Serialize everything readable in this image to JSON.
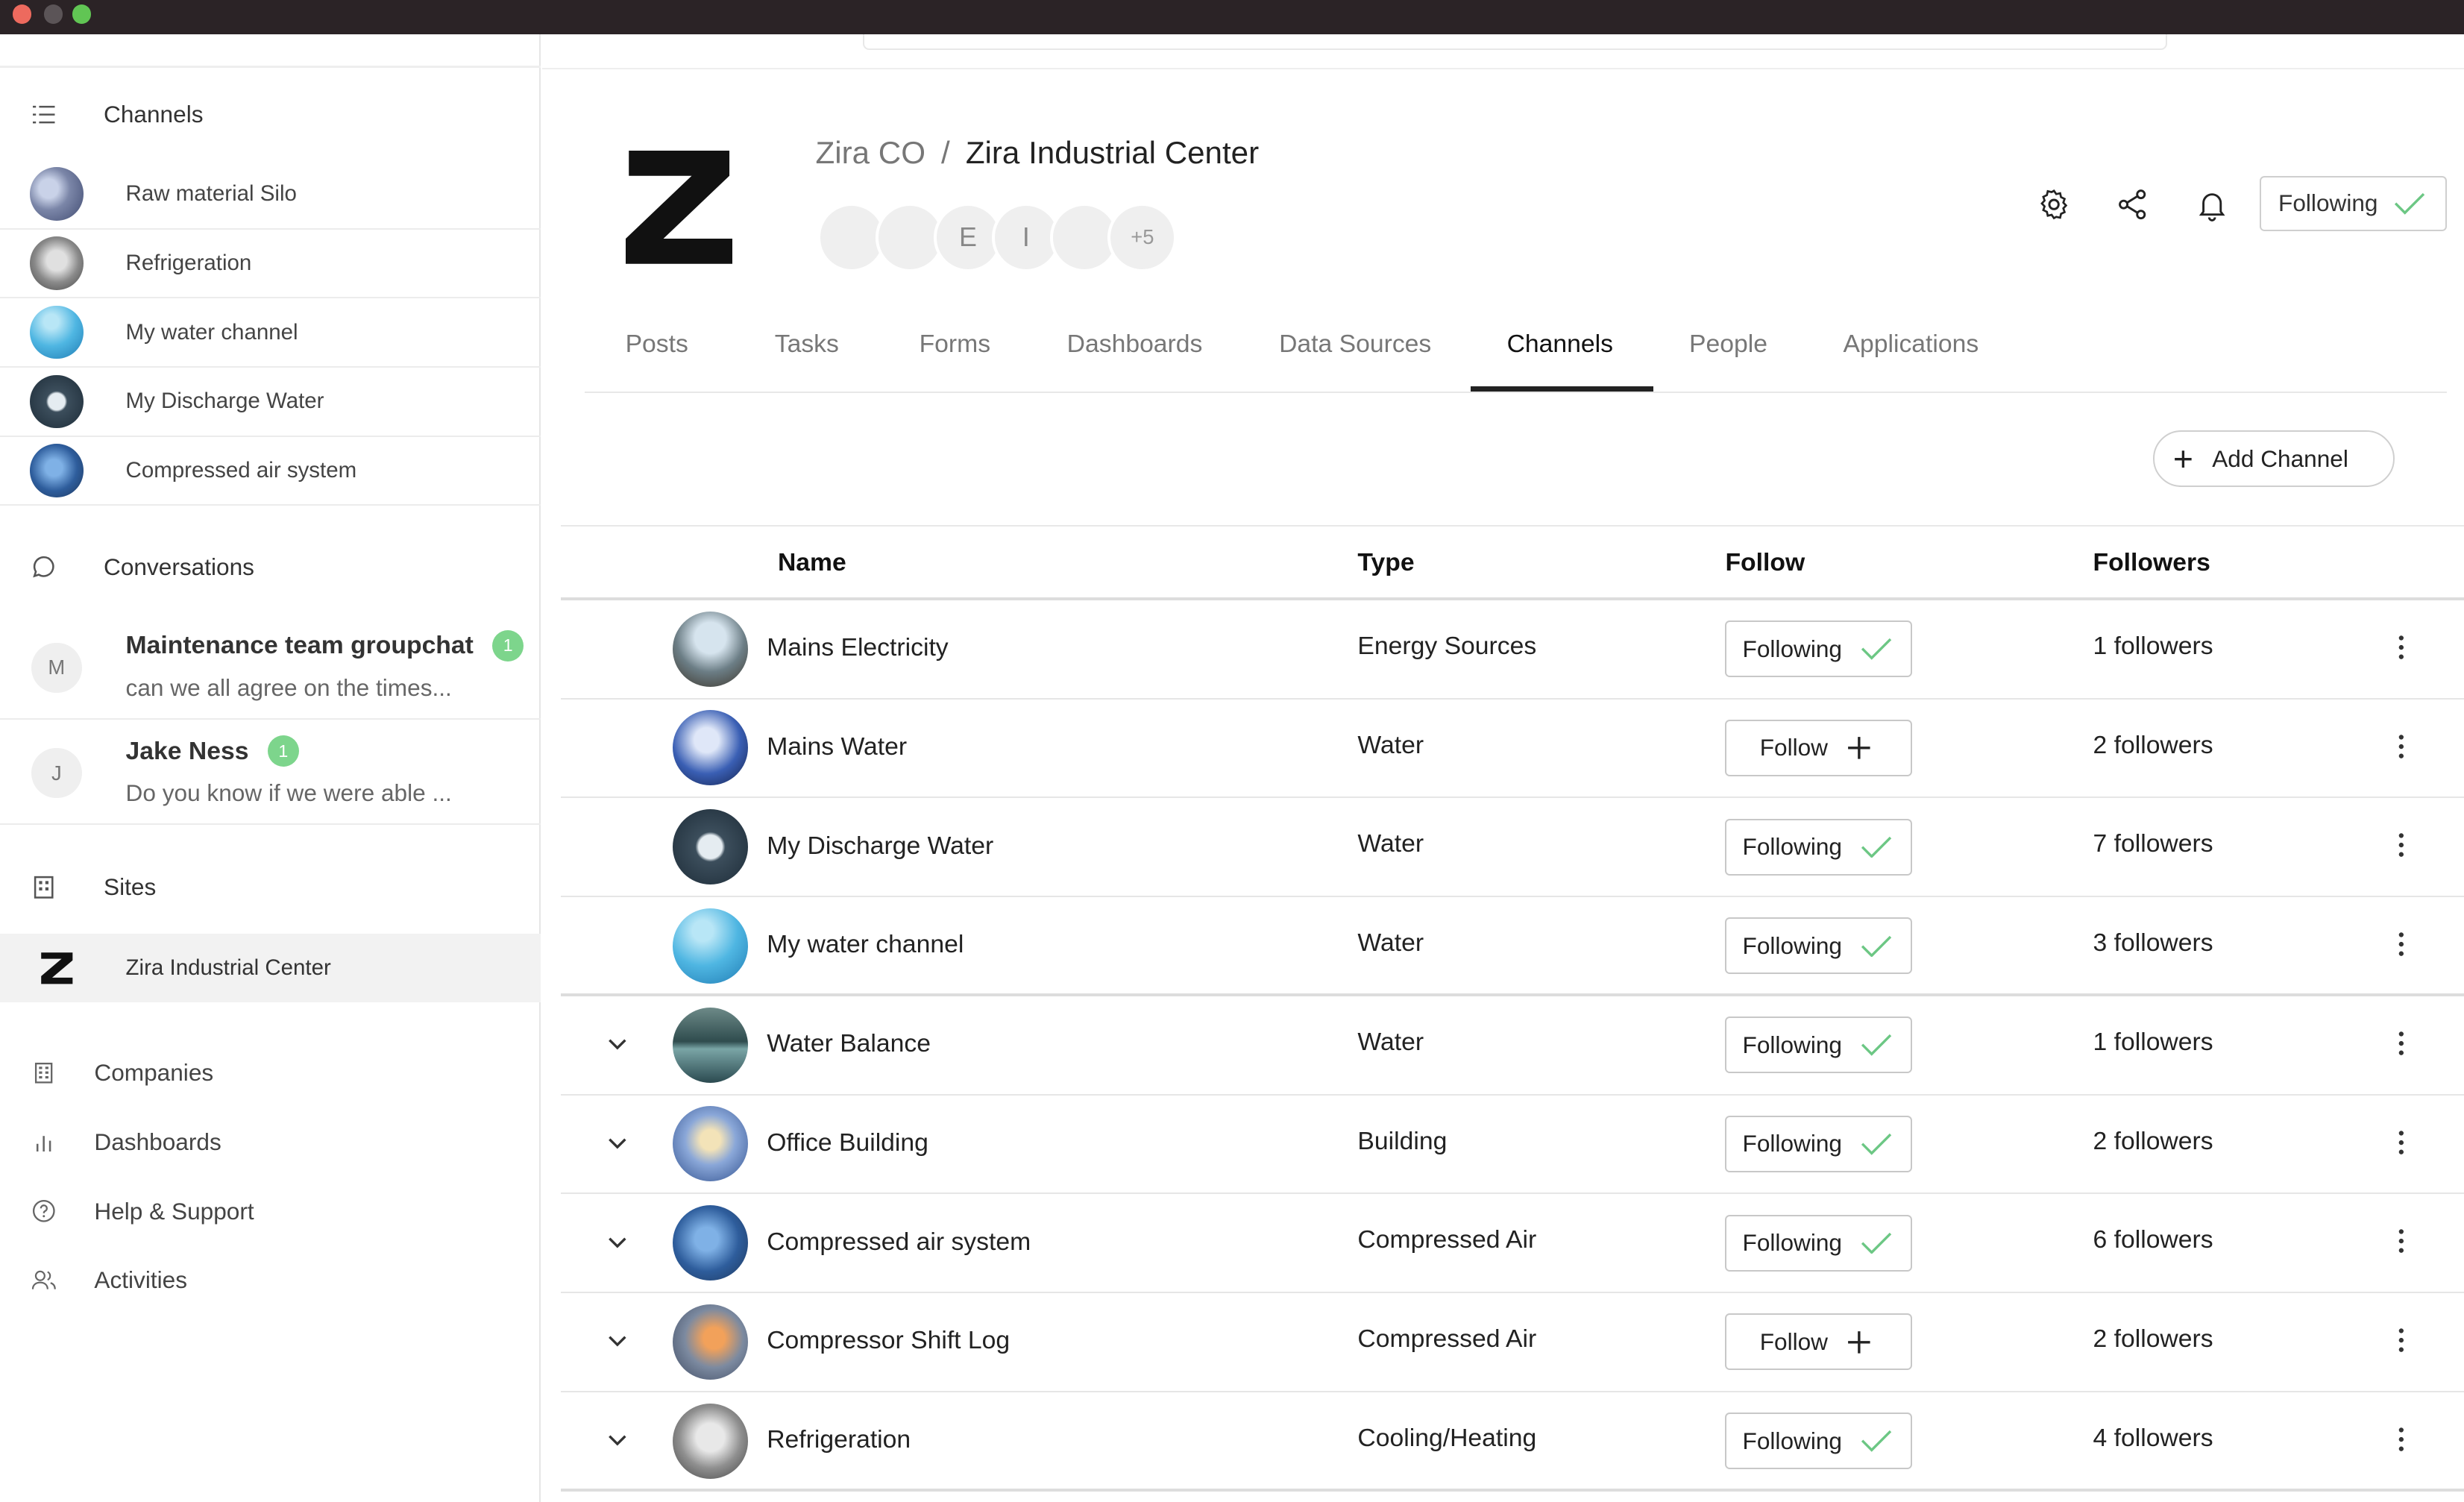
{
  "sidebar": {
    "channels_header": "Channels",
    "channels": [
      {
        "label": "Raw material Silo",
        "thumb": "t-silo"
      },
      {
        "label": "Refrigeration",
        "thumb": "t-fridge"
      },
      {
        "label": "My water channel",
        "thumb": "t-water"
      },
      {
        "label": "My Discharge Water",
        "thumb": "t-meter"
      },
      {
        "label": "Compressed air system",
        "thumb": "t-air"
      }
    ],
    "conversations_header": "Conversations",
    "conversations": [
      {
        "initial": "M",
        "name": "Maintenance team groupchat",
        "badge": "1",
        "message": "can we all agree on the times..."
      },
      {
        "initial": "J",
        "name": "Jake Ness",
        "badge": "1",
        "message": "Do you know if we were able ..."
      }
    ],
    "sites_header": "Sites",
    "site": "Zira Industrial Center",
    "nav": [
      {
        "label": "Companies",
        "icon": "building-icon"
      },
      {
        "label": "Dashboards",
        "icon": "bar-chart-icon"
      },
      {
        "label": "Help & Support",
        "icon": "help-circle-icon"
      },
      {
        "label": "Activities",
        "icon": "users-icon"
      }
    ]
  },
  "header": {
    "org": "Zira CO",
    "separator": "/",
    "site": "Zira Industrial Center",
    "member_initials": [
      "E",
      "I"
    ],
    "more_members": "+5",
    "following_label": "Following"
  },
  "tabs": [
    "Posts",
    "Tasks",
    "Forms",
    "Dashboards",
    "Data Sources",
    "Channels",
    "People",
    "Applications"
  ],
  "active_tab": "Channels",
  "add_channel_label": "Add Channel",
  "table": {
    "columns": {
      "name": "Name",
      "type": "Type",
      "follow": "Follow",
      "followers": "Followers"
    },
    "rows": [
      {
        "name": "Mains Electricity",
        "type": "Energy Sources",
        "follow": "Following",
        "followers": "1 followers",
        "thumb": "t-elec",
        "expandable": false
      },
      {
        "name": "Mains Water",
        "type": "Water",
        "follow": "Follow",
        "followers": "2 followers",
        "thumb": "t-mains",
        "expandable": false
      },
      {
        "name": "My Discharge Water",
        "type": "Water",
        "follow": "Following",
        "followers": "7 followers",
        "thumb": "t-meter",
        "expandable": false
      },
      {
        "name": "My water channel",
        "type": "Water",
        "follow": "Following",
        "followers": "3 followers",
        "thumb": "t-water",
        "expandable": false
      },
      {
        "name": "Water Balance",
        "type": "Water",
        "follow": "Following",
        "followers": "1 followers",
        "thumb": "t-balance",
        "expandable": true
      },
      {
        "name": "Office Building",
        "type": "Building",
        "follow": "Following",
        "followers": "2 followers",
        "thumb": "t-office",
        "expandable": true
      },
      {
        "name": "Compressed air system",
        "type": "Compressed Air",
        "follow": "Following",
        "followers": "6 followers",
        "thumb": "t-air",
        "expandable": true
      },
      {
        "name": "Compressor Shift Log",
        "type": "Compressed Air",
        "follow": "Follow",
        "followers": "2 followers",
        "thumb": "t-log",
        "expandable": true
      },
      {
        "name": "Refrigeration",
        "type": "Cooling/Heating",
        "follow": "Following",
        "followers": "4 followers",
        "thumb": "t-refrig",
        "expandable": true
      }
    ]
  },
  "colors": {
    "accent_check": "#6cc784",
    "badge": "#7dd58c",
    "title_bar": "#2b2326"
  }
}
